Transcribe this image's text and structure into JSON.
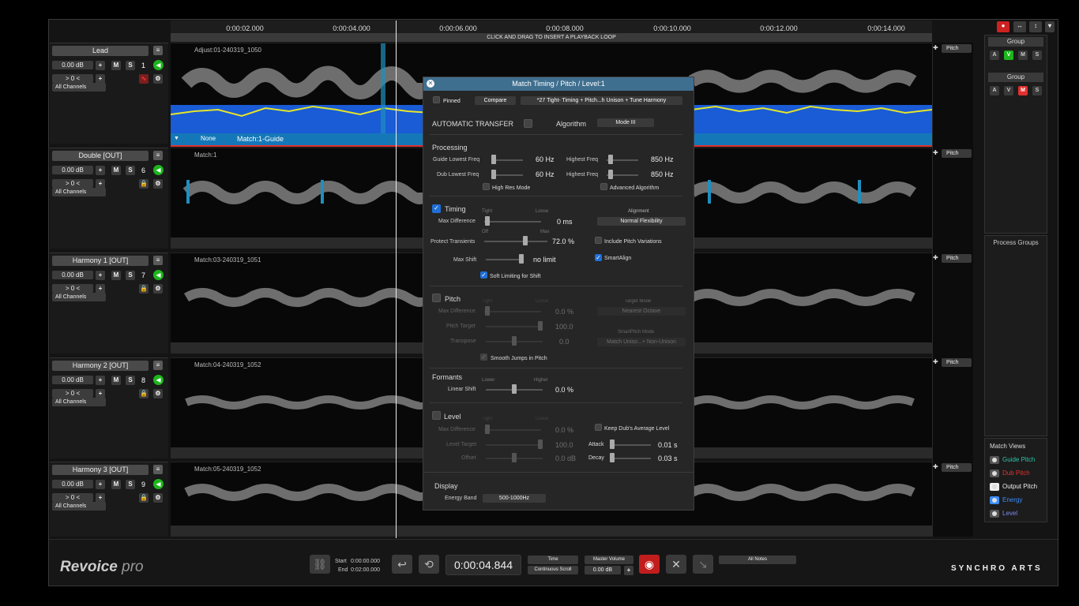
{
  "ruler": {
    "ticks": [
      "0:00:02.000",
      "0:00:04.000",
      "0:00:06.000",
      "0:00:08.000",
      "0:00:10.000",
      "0:00:12.000",
      "0:00:14.000"
    ],
    "loop_hint": "CLICK AND DRAG TO INSERT A PLAYBACK LOOP"
  },
  "tracks": [
    {
      "name": "Lead",
      "gain": "0.00 dB",
      "pan": "> 0 <",
      "num": "1",
      "channels": "All Channels",
      "lane_label": "Adjust:01-240319_1050",
      "pitch": "Pitch"
    },
    {
      "name": "Double [OUT]",
      "gain": "0.00 dB",
      "pan": "> 0 <",
      "num": "6",
      "channels": "All Channels",
      "lane_label": "Match:1",
      "pitch": "Pitch"
    },
    {
      "name": "Harmony 1 [OUT]",
      "gain": "0.00 dB",
      "pan": "> 0 <",
      "num": "7",
      "channels": "All Channels",
      "lane_label": "Match:03-240319_1051",
      "pitch": "Pitch"
    },
    {
      "name": "Harmony  2 [OUT]",
      "gain": "0.00 dB",
      "pan": "> 0 <",
      "num": "8",
      "channels": "All Channels",
      "lane_label": "Match:04-240319_1052",
      "pitch": "Pitch"
    },
    {
      "name": "Harmony 3 [OUT]",
      "gain": "0.00 dB",
      "pan": "> 0 <",
      "num": "9",
      "channels": "All Channels",
      "lane_label": "Match:05-240319_1052",
      "pitch": "Pitch"
    }
  ],
  "guide_bar": {
    "none_label": "None",
    "match_label": "Match:1-Guide"
  },
  "buttons": {
    "m": "M",
    "s": "S",
    "plus": "+"
  },
  "dialog": {
    "title": "Match Timing / Pitch / Level:1",
    "pinned": "Pinned",
    "compare": "Compare",
    "preset": "*27 Tight- Timing + Pitch...h Unison + Tune Harmony",
    "auto_transfer": "AUTOMATIC TRANSFER",
    "algorithm_label": "Algorithm",
    "algorithm_value": "Mode III",
    "processing": {
      "title": "Processing",
      "guide_low_label": "Guide Lowest Freq",
      "guide_low_value": "60 Hz",
      "guide_high_label": "Highest Freq",
      "guide_high_value": "850 Hz",
      "dub_low_label": "Dub Lowest Freq",
      "dub_low_value": "60 Hz",
      "dub_high_label": "Highest Freq",
      "dub_high_value": "850 Hz",
      "high_res": "High Res Mode",
      "advanced": "Advanced Algorithm"
    },
    "timing": {
      "title": "Timing",
      "tight": "Tight",
      "loose": "Loose",
      "max_diff_label": "Max Difference",
      "max_diff_value": "0 ms",
      "alignment_label": "Alignment",
      "alignment_value": "Normal Flexibility",
      "off": "Off",
      "max": "Max",
      "protect_label": "Protect Transients",
      "protect_value": "72.0 %",
      "include_pitch": "Include Pitch Variations",
      "max_shift_label": "Max Shift",
      "max_shift_value": "no limit",
      "smartalign": "SmartAlign",
      "soft_limit": "Soft Limiting for Shift"
    },
    "pitch": {
      "title": "Pitch",
      "tight": "Tight",
      "loose": "Loose",
      "max_diff_label": "Max Difference",
      "max_diff_value": "0.0 %",
      "target_mode_label": "Target Mode",
      "target_mode_value": "Nearest Octave",
      "pitch_target_label": "Pitch Target",
      "pitch_target_value": "100.0",
      "smartpitch_label": "SmartPitch Mode",
      "smartpitch_value": "Match Uniso...+ Non-Unison",
      "transpose_label": "Transpose",
      "transpose_value": "0.0",
      "smooth": "Smooth Jumps in Pitch"
    },
    "formants": {
      "title": "Formants",
      "lower": "Lower",
      "higher": "Higher",
      "linear_label": "Linear Shift",
      "linear_value": "0.0 %"
    },
    "level": {
      "title": "Level",
      "tight": "Tight",
      "loose": "Loose",
      "max_diff_label": "Max Difference",
      "max_diff_value": "0.0 %",
      "keep_avg": "Keep Dub's Average Level",
      "level_target_label": "Level Target",
      "level_target_value": "100.0",
      "attack_label": "Attack",
      "attack_value": "0.01 s",
      "offset_label": "Offset",
      "offset_value": "0.0 dB",
      "decay_label": "Decay",
      "decay_value": "0.03 s"
    },
    "display": {
      "title": "Display",
      "energy_label": "Energy Band",
      "energy_value": "500-1000Hz"
    }
  },
  "right_panel": {
    "group1_title": "Group",
    "group2_title": "Group",
    "group_buttons": [
      "A",
      "V",
      "M",
      "S"
    ],
    "process_groups": "Process Groups",
    "match_views_title": "Match Views",
    "match_views": [
      {
        "label": "Guide Pitch",
        "color": "#2ec4a9"
      },
      {
        "label": "Dub Pitch",
        "color": "#e83030"
      },
      {
        "label": "Output Pitch",
        "color": "#eeeeee"
      },
      {
        "label": "Energy",
        "color": "#3a8dff"
      },
      {
        "label": "Level",
        "color": "#7d8df0"
      }
    ]
  },
  "transport": {
    "start_label": "Start",
    "start_value": "0:00:00.000",
    "end_label": "End",
    "end_value": "0:02:00.000",
    "time_display": "0:00:04.844",
    "time_mode": "Time",
    "scroll_mode": "Continuous Scroll",
    "master_volume": "Master Volume",
    "master_value": "0.00 dB",
    "notes": "All Notes"
  },
  "brand": {
    "logo_main": "Revoice",
    "logo_sub": "pro",
    "synchro": "SYNCHRO ARTS"
  },
  "colors": {
    "accent": "#1f6fd6",
    "energy": "#1a5bd6",
    "guide_line": "#e5e52a",
    "mute_red": "#e03030"
  }
}
